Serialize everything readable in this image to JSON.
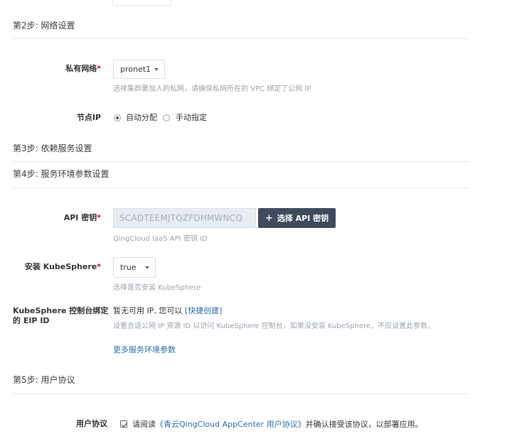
{
  "step2": {
    "title": "第2步: 网络设置",
    "private_network": {
      "label": "私有网络",
      "required_mark": "*",
      "value": "pronet1",
      "hint": "选择集群要加入的私网，请确保私网所在的 VPC 绑定了公网 IP"
    },
    "node_ip": {
      "label": "节点IP",
      "options": [
        {
          "label": "自动分配",
          "checked": true
        },
        {
          "label": "手动指定",
          "checked": false
        }
      ]
    }
  },
  "step3": {
    "title": "第3步: 依赖服务设置"
  },
  "step4": {
    "title": "第4步: 服务环境参数设置",
    "api_key": {
      "label": "API 密钥",
      "required_mark": "*",
      "value": "SCADTEEMJTQZFDHMWNCQ",
      "button_icon": "+",
      "button_label": "选择 API 密钥",
      "hint": "QingCloud IaaS API 密钥 ID"
    },
    "install_kubesphere": {
      "label": "安装 KubeSphere",
      "required_mark": "*",
      "value": "true",
      "hint": "选择是否安装 KubeSphere"
    },
    "eip": {
      "label_line1": "KubeSphere 控制台绑定",
      "label_line2": "的 EIP ID",
      "status_text": "暂无可用 IP, 您可以",
      "quick_create_link": "[快捷创建]",
      "hint": "设置合适公网 IP 资源 ID 以访问 KubeSphere 控制台，如果没安装 KubeSphere，不应设置此参数。"
    },
    "more_params_link": "更多服务环境参数"
  },
  "step5": {
    "title": "第5步: 用户协议",
    "agreement": {
      "label": "用户协议",
      "checked": true,
      "text_before": "请阅读",
      "link": "《青云QingCloud AppCenter 用户协议》",
      "text_after": "并确认接受该协议，以部署应用。"
    }
  },
  "colors": {
    "required": "#d0021b",
    "link": "#2b6cb0",
    "primary_button": "#3f4b5c",
    "hint": "#9aa3ad",
    "divider": "#e6e9ed"
  }
}
